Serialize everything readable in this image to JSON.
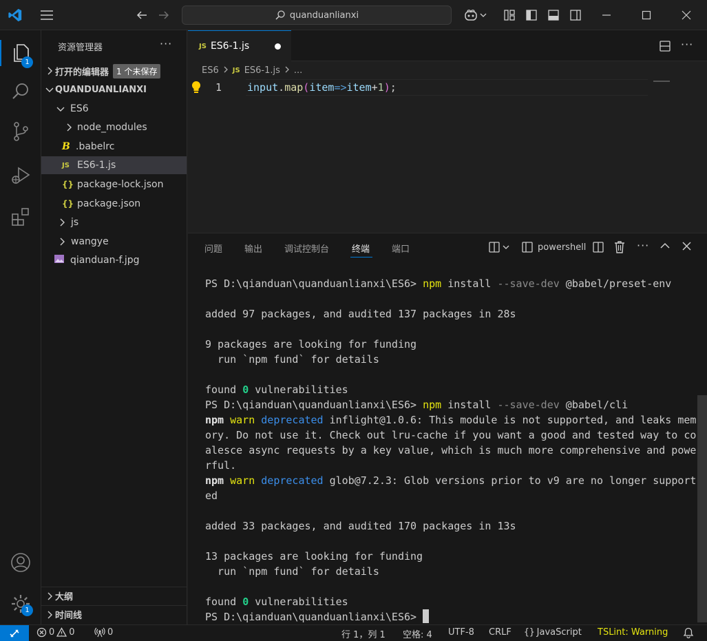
{
  "titlebar": {
    "search_text": "quanduanlianxi"
  },
  "activity": {
    "explorer_badge": "1",
    "settings_badge": "1"
  },
  "sidebar": {
    "title": "资源管理器",
    "open_editors": {
      "label": "打开的编辑器",
      "unsaved": "1 个未保存"
    },
    "root": "QUANDUANLIANXI",
    "items": [
      {
        "label": "ES6"
      },
      {
        "label": "node_modules"
      },
      {
        "label": ".babelrc"
      },
      {
        "label": "ES6-1.js"
      },
      {
        "label": "package-lock.json"
      },
      {
        "label": "package.json"
      },
      {
        "label": "js"
      },
      {
        "label": "wangye"
      },
      {
        "label": "qianduan-f.jpg"
      }
    ],
    "outline": "大纲",
    "timeline": "时间线"
  },
  "editor": {
    "tab_label": "ES6-1.js",
    "breadcrumb": {
      "folder": "ES6",
      "file": "ES6-1.js",
      "more": "..."
    },
    "line_number": "1",
    "code": {
      "a": "input",
      "b": ".",
      "c": "map",
      "d": "(",
      "e": "item",
      "f": "=>",
      "g": "item",
      "h": "+",
      "i": "1",
      "j": ")",
      "k": ";"
    }
  },
  "panel": {
    "tabs": [
      "问题",
      "输出",
      "调试控制台",
      "终端",
      "端口"
    ],
    "shell": "powershell",
    "terminal": {
      "prompt": "PS D:\\qianduan\\quanduanlianxi\\ES6> ",
      "cmd1": {
        "npm": "npm",
        "install": " install ",
        "flag": "--save-dev",
        "pkg": " @babel/preset-env"
      },
      "added1": "added 97 packages, and audited 137 packages in 28s",
      "fund1a": "9 packages are looking for funding",
      "fund_b": "  run `npm fund` for details",
      "found_pre": "found ",
      "zero": "0",
      "found_post": " vulnerabilities",
      "cmd2": {
        "pkg": " @babel/cli"
      },
      "npm_word": "npm",
      "warn": "warn",
      "deprecated": "deprecated",
      "warn1_l1": " inflight@1.0.6: This module is not supported, and leaks mem",
      "warn1_l2": "ory. Do not use it. Check out lru-cache if you want a good and tested way to co",
      "warn1_l3": "alesce async requests by a key value, which is much more comprehensive and powe",
      "warn1_l4": "rful.",
      "warn2_l1": " glob@7.2.3: Glob versions prior to v9 are no longer support",
      "warn2_l2": "ed",
      "added2": "added 33 packages, and audited 170 packages in 13s",
      "fund2a": "13 packages are looking for funding"
    }
  },
  "status": {
    "errors": "0",
    "warnings": "0",
    "ports": "0",
    "position": "行 1，列 1",
    "spaces": "空格: 4",
    "encoding": "UTF-8",
    "eol": "CRLF",
    "language": "JavaScript",
    "tslint": "TSLint: Warning"
  }
}
